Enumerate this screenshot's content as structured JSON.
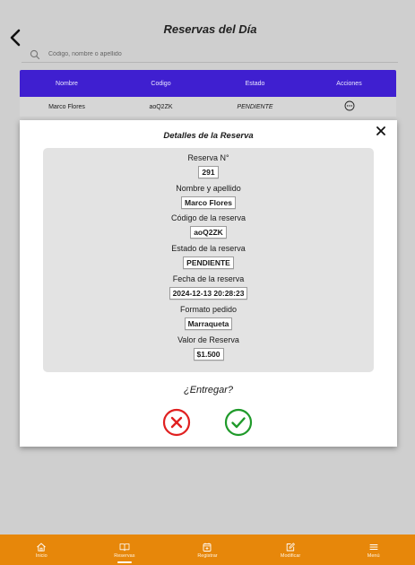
{
  "header": {
    "title": "Reservas del Día",
    "back_icon": "chevron-left-icon"
  },
  "search": {
    "placeholder": "Código, nombre o apellido",
    "value": "",
    "icon": "search-icon"
  },
  "table": {
    "header_color": "#3f1fd0",
    "columns": [
      "Nombre",
      "Codigo",
      "Estado",
      "Acciones"
    ],
    "rows": [
      {
        "nombre": "Marco Flores",
        "codigo": "aoQ2ZK",
        "estado": "PENDIENTE",
        "accion_icon": "more-horizontal-icon"
      }
    ]
  },
  "modal": {
    "title": "Detalles de la Reserva",
    "close_icon": "close-icon",
    "fields": [
      {
        "label": "Reserva N°",
        "value": "291"
      },
      {
        "label": "Nombre y apellido",
        "value": "Marco Flores"
      },
      {
        "label": "Código de la reserva",
        "value": "aoQ2ZK"
      },
      {
        "label": "Estado de la reserva",
        "value": "PENDIENTE"
      },
      {
        "label": "Fecha de la reserva",
        "value": "2024-12-13 20:28:23"
      },
      {
        "label": "Formato pedido",
        "value": "Marraqueta"
      },
      {
        "label": "Valor de Reserva",
        "value": "$1.500"
      }
    ],
    "question": "¿Entregar?",
    "reject_icon": "x-circle-icon",
    "confirm_icon": "check-circle-icon",
    "reject_color": "#e02020",
    "confirm_color": "#1f9a2a"
  },
  "nav": {
    "color": "#e7870a",
    "items": [
      {
        "label": "Inicio",
        "icon": "home-icon",
        "active": false
      },
      {
        "label": "Reservas",
        "icon": "book-open-icon",
        "active": true
      },
      {
        "label": "Registrar",
        "icon": "calendar-plus-icon",
        "active": false
      },
      {
        "label": "Modificar",
        "icon": "edit-icon",
        "active": false
      },
      {
        "label": "Menú",
        "icon": "menu-icon",
        "active": false
      }
    ]
  }
}
